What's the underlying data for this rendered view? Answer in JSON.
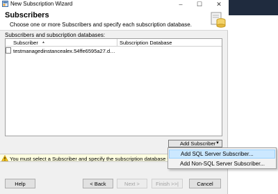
{
  "window": {
    "title": "New Subscription Wizard"
  },
  "header": {
    "title": "Subscribers",
    "subtitle": "Choose one or more Subscribers and specify each subscription database."
  },
  "grid": {
    "section_label": "Subscribers and subscription databases:",
    "columns": [
      "Subscriber",
      "Subscription Database"
    ],
    "sort_indicator": "▲",
    "rows": [
      {
        "subscriber": "testmanagedinstancealex.54ffe6595a27.datab...",
        "database": "",
        "checked": false
      }
    ]
  },
  "add_button": {
    "label": "Add Subscriber",
    "caret": "▼"
  },
  "status": {
    "text": "You must select a Subscriber and specify the subscription database to conti"
  },
  "menu": {
    "items": [
      {
        "label": "Add SQL Server Subscriber...",
        "selected": true
      },
      {
        "label": "Add Non-SQL Server Subscriber...",
        "selected": false
      }
    ]
  },
  "footer": {
    "help": "Help",
    "back": "< Back",
    "next": "Next >",
    "finish": "Finish >>|",
    "cancel": "Cancel"
  },
  "colors": {
    "status_bg": "#ffffe1",
    "menu_selected": "#cce8ff",
    "title_dark_strip": "#1f2b3e"
  },
  "icons": {
    "app": "wizard-app-icon",
    "header": "database-wizard-icon",
    "warning": "warning-icon",
    "minimize": "minimize-icon",
    "maximize": "maximize-icon",
    "close": "close-icon"
  }
}
